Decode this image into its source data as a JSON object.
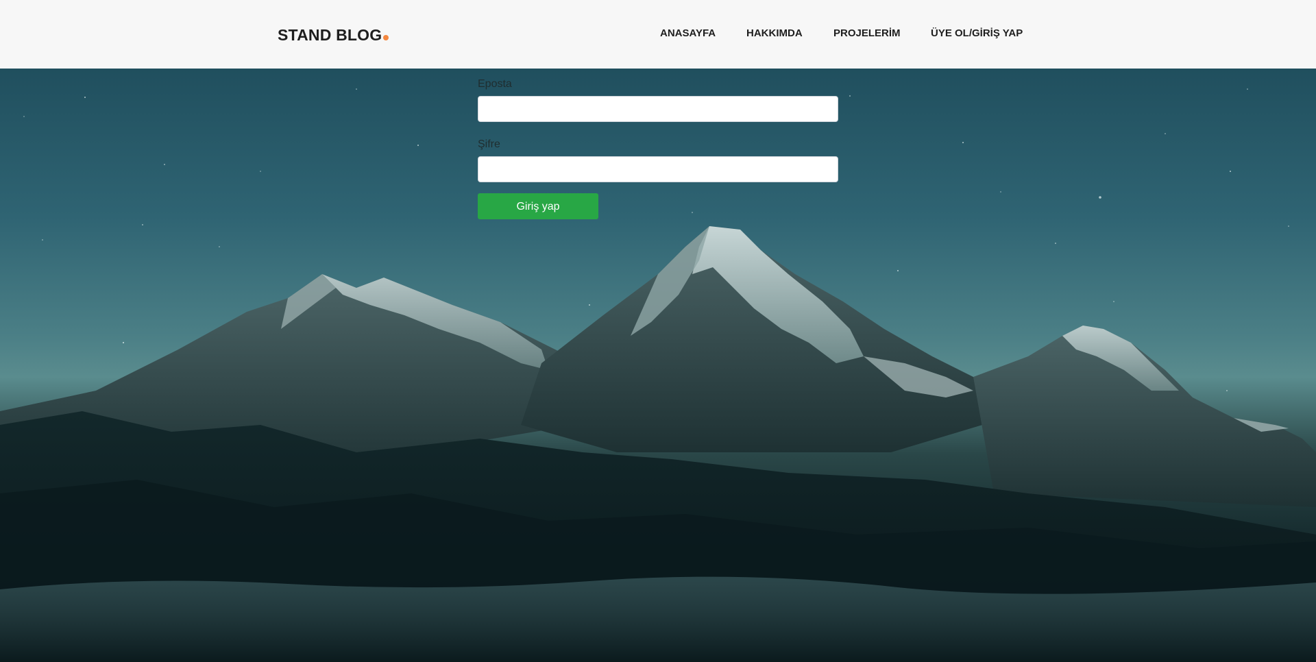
{
  "header": {
    "logo_text": "STAND BLOG",
    "nav": [
      {
        "label": "ANASAYFA"
      },
      {
        "label": "HAKKIMDA"
      },
      {
        "label": "PROJELERİM"
      },
      {
        "label": "ÜYE OL/GİRİŞ YAP"
      }
    ]
  },
  "login_form": {
    "email_label": "Eposta",
    "email_value": "",
    "password_label": "Şifre",
    "password_value": "",
    "submit_label": "Giriş yap"
  },
  "colors": {
    "header_bg": "#f7f7f7",
    "logo_dot": "#f48840",
    "button_bg": "#28a745",
    "text": "#1e1e1e"
  },
  "background": {
    "description_icon": "mountain-night-sky-photo"
  }
}
